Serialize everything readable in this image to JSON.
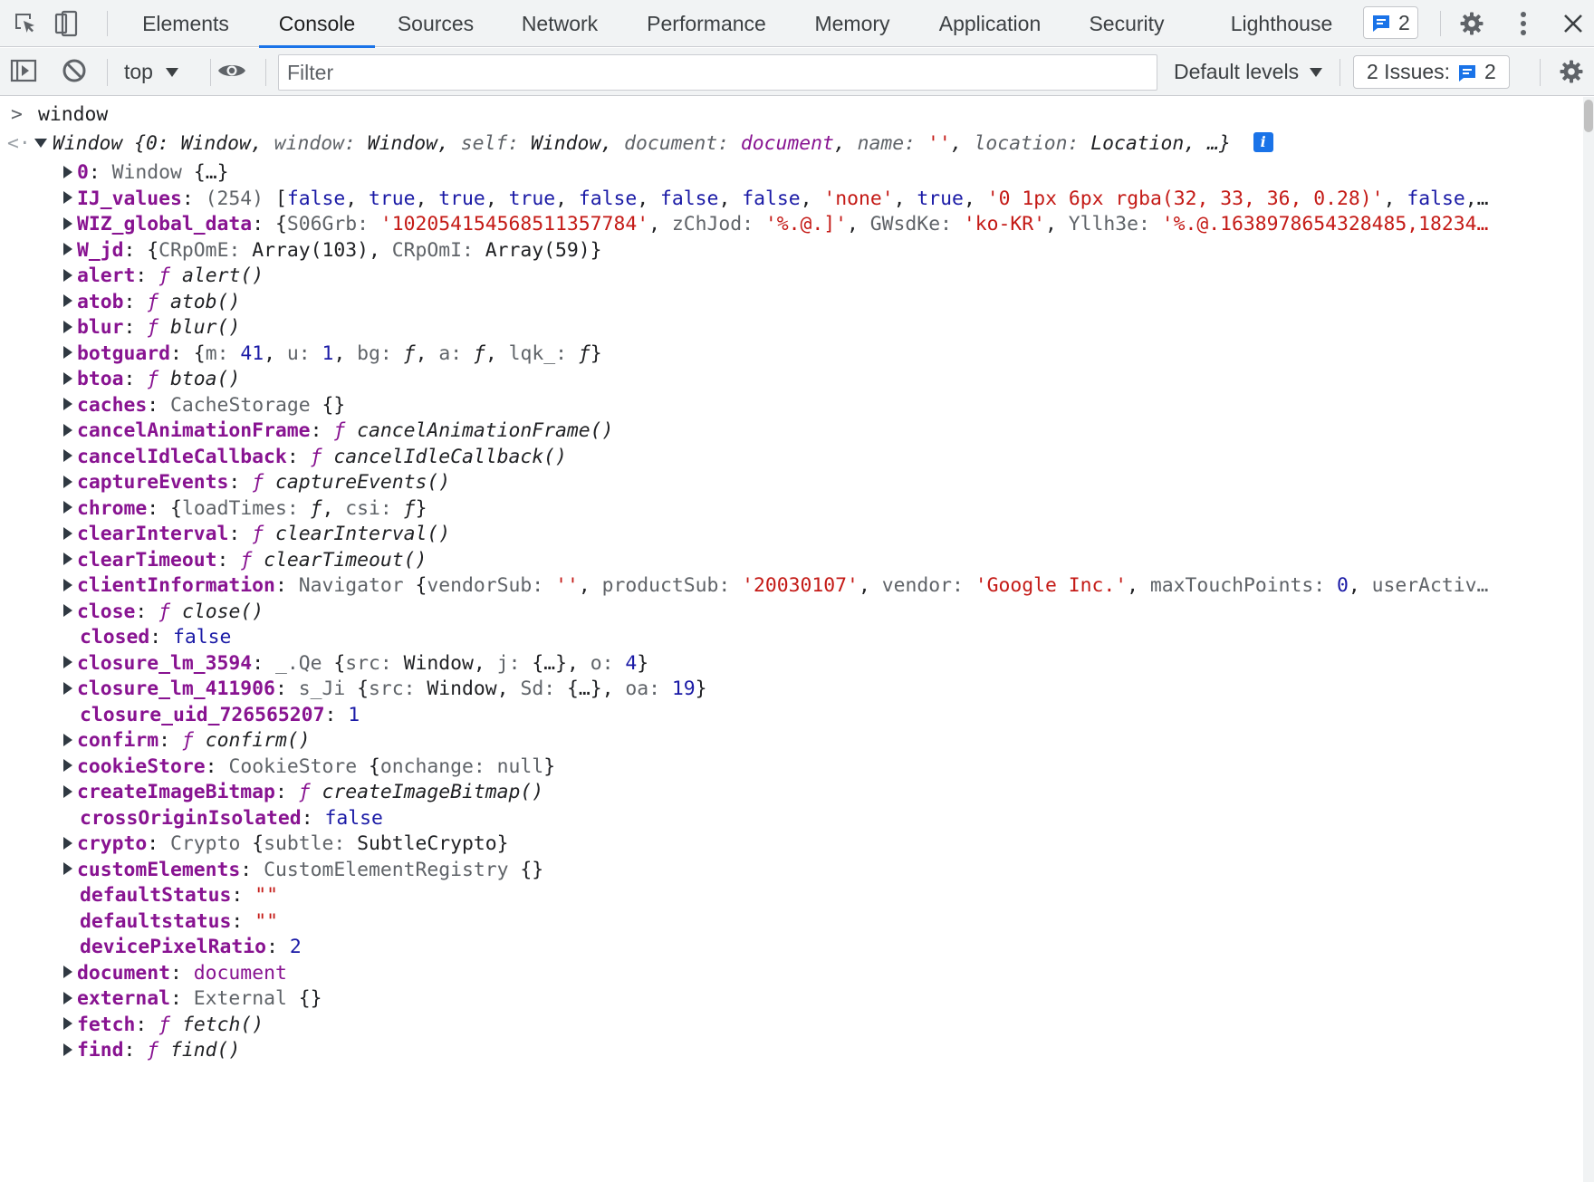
{
  "tabs": [
    {
      "label": "Elements",
      "active": false
    },
    {
      "label": "Console",
      "active": true
    },
    {
      "label": "Sources",
      "active": false
    },
    {
      "label": "Network",
      "active": false
    },
    {
      "label": "Performance",
      "active": false
    },
    {
      "label": "Memory",
      "active": false
    },
    {
      "label": "Application",
      "active": false
    },
    {
      "label": "Security",
      "active": false
    },
    {
      "label": "Lighthouse",
      "active": false
    }
  ],
  "tabbar": {
    "messages_count": "2"
  },
  "toolbar": {
    "context": "top",
    "filter_placeholder": "Filter",
    "levels": "Default levels",
    "issues_label": "2 Issues:",
    "issues_count": "2"
  },
  "colors": {
    "accent": "#1a73e8",
    "key": "#881391",
    "string": "#c41a16",
    "number": "#1a1aa6"
  },
  "console": {
    "input": "window",
    "summary": [
      {
        "c": "t i",
        "v": "Window {"
      },
      {
        "c": "t i",
        "v": "0: Window, "
      },
      {
        "c": "g i",
        "v": "window: "
      },
      {
        "c": "t i",
        "v": "Window, "
      },
      {
        "c": "g i",
        "v": "self: "
      },
      {
        "c": "t i",
        "v": "Window, "
      },
      {
        "c": "g i",
        "v": "document: "
      },
      {
        "c": "kn i",
        "v": "document"
      },
      {
        "c": "t i",
        "v": ", "
      },
      {
        "c": "g i",
        "v": "name: "
      },
      {
        "c": "s i",
        "v": "''"
      },
      {
        "c": "t i",
        "v": ", "
      },
      {
        "c": "g i",
        "v": "location: "
      },
      {
        "c": "t i",
        "v": "Location, …}"
      }
    ],
    "props": [
      {
        "expand": true,
        "key": "0",
        "parts": [
          {
            "c": "g",
            "v": "Window "
          },
          {
            "c": "t",
            "v": "{…}"
          }
        ]
      },
      {
        "expand": true,
        "key": "IJ_values",
        "parts": [
          {
            "c": "g",
            "v": "(254) "
          },
          {
            "c": "t",
            "v": "["
          },
          {
            "c": "n",
            "v": "false"
          },
          {
            "c": "t",
            "v": ", "
          },
          {
            "c": "n",
            "v": "true"
          },
          {
            "c": "t",
            "v": ", "
          },
          {
            "c": "n",
            "v": "true"
          },
          {
            "c": "t",
            "v": ", "
          },
          {
            "c": "n",
            "v": "true"
          },
          {
            "c": "t",
            "v": ", "
          },
          {
            "c": "n",
            "v": "false"
          },
          {
            "c": "t",
            "v": ", "
          },
          {
            "c": "n",
            "v": "false"
          },
          {
            "c": "t",
            "v": ", "
          },
          {
            "c": "n",
            "v": "false"
          },
          {
            "c": "t",
            "v": ", "
          },
          {
            "c": "s",
            "v": "'none'"
          },
          {
            "c": "t",
            "v": ", "
          },
          {
            "c": "n",
            "v": "true"
          },
          {
            "c": "t",
            "v": ", "
          },
          {
            "c": "s",
            "v": "'0 1px 6px rgba(32, 33, 36, 0.28)'"
          },
          {
            "c": "t",
            "v": ", "
          },
          {
            "c": "n",
            "v": "false"
          },
          {
            "c": "t",
            "v": ",…"
          }
        ]
      },
      {
        "expand": true,
        "key": "WIZ_global_data",
        "parts": [
          {
            "c": "t",
            "v": "{"
          },
          {
            "c": "g",
            "v": "S06Grb: "
          },
          {
            "c": "s",
            "v": "'102054154568511357784'"
          },
          {
            "c": "t",
            "v": ", "
          },
          {
            "c": "g",
            "v": "zChJod: "
          },
          {
            "c": "s",
            "v": "'%.@.]'"
          },
          {
            "c": "t",
            "v": ", "
          },
          {
            "c": "g",
            "v": "GWsdKe: "
          },
          {
            "c": "s",
            "v": "'ko-KR'"
          },
          {
            "c": "t",
            "v": ", "
          },
          {
            "c": "g",
            "v": "Yllh3e: "
          },
          {
            "c": "s",
            "v": "'%.@.1638978654328485,18234…"
          }
        ]
      },
      {
        "expand": true,
        "key": "W_jd",
        "parts": [
          {
            "c": "t",
            "v": "{"
          },
          {
            "c": "g",
            "v": "CRpOmE: "
          },
          {
            "c": "t",
            "v": "Array(103), "
          },
          {
            "c": "g",
            "v": "CRpOmI: "
          },
          {
            "c": "t",
            "v": "Array(59)}"
          }
        ]
      },
      {
        "expand": true,
        "key": "alert",
        "parts": [
          {
            "c": "kn i",
            "v": "ƒ "
          },
          {
            "c": "t i",
            "v": "alert()"
          }
        ]
      },
      {
        "expand": true,
        "key": "atob",
        "parts": [
          {
            "c": "kn i",
            "v": "ƒ "
          },
          {
            "c": "t i",
            "v": "atob()"
          }
        ]
      },
      {
        "expand": true,
        "key": "blur",
        "parts": [
          {
            "c": "kn i",
            "v": "ƒ "
          },
          {
            "c": "t i",
            "v": "blur()"
          }
        ]
      },
      {
        "expand": true,
        "key": "botguard",
        "parts": [
          {
            "c": "t",
            "v": "{"
          },
          {
            "c": "g",
            "v": "m: "
          },
          {
            "c": "n",
            "v": "41"
          },
          {
            "c": "t",
            "v": ", "
          },
          {
            "c": "g",
            "v": "u: "
          },
          {
            "c": "n",
            "v": "1"
          },
          {
            "c": "t",
            "v": ", "
          },
          {
            "c": "g",
            "v": "bg: "
          },
          {
            "c": "t i",
            "v": "ƒ"
          },
          {
            "c": "t",
            "v": ", "
          },
          {
            "c": "g",
            "v": "a: "
          },
          {
            "c": "t i",
            "v": "ƒ"
          },
          {
            "c": "t",
            "v": ", "
          },
          {
            "c": "g",
            "v": "lqk_: "
          },
          {
            "c": "t i",
            "v": "ƒ"
          },
          {
            "c": "t",
            "v": "}"
          }
        ]
      },
      {
        "expand": true,
        "key": "btoa",
        "parts": [
          {
            "c": "kn i",
            "v": "ƒ "
          },
          {
            "c": "t i",
            "v": "btoa()"
          }
        ]
      },
      {
        "expand": true,
        "key": "caches",
        "parts": [
          {
            "c": "g",
            "v": "CacheStorage "
          },
          {
            "c": "t",
            "v": "{}"
          }
        ]
      },
      {
        "expand": true,
        "key": "cancelAnimationFrame",
        "parts": [
          {
            "c": "kn i",
            "v": "ƒ "
          },
          {
            "c": "t i",
            "v": "cancelAnimationFrame()"
          }
        ]
      },
      {
        "expand": true,
        "key": "cancelIdleCallback",
        "parts": [
          {
            "c": "kn i",
            "v": "ƒ "
          },
          {
            "c": "t i",
            "v": "cancelIdleCallback()"
          }
        ]
      },
      {
        "expand": true,
        "key": "captureEvents",
        "parts": [
          {
            "c": "kn i",
            "v": "ƒ "
          },
          {
            "c": "t i",
            "v": "captureEvents()"
          }
        ]
      },
      {
        "expand": true,
        "key": "chrome",
        "parts": [
          {
            "c": "t",
            "v": "{"
          },
          {
            "c": "g",
            "v": "loadTimes: "
          },
          {
            "c": "t i",
            "v": "ƒ"
          },
          {
            "c": "t",
            "v": ", "
          },
          {
            "c": "g",
            "v": "csi: "
          },
          {
            "c": "t i",
            "v": "ƒ"
          },
          {
            "c": "t",
            "v": "}"
          }
        ]
      },
      {
        "expand": true,
        "key": "clearInterval",
        "parts": [
          {
            "c": "kn i",
            "v": "ƒ "
          },
          {
            "c": "t i",
            "v": "clearInterval()"
          }
        ]
      },
      {
        "expand": true,
        "key": "clearTimeout",
        "parts": [
          {
            "c": "kn i",
            "v": "ƒ "
          },
          {
            "c": "t i",
            "v": "clearTimeout()"
          }
        ]
      },
      {
        "expand": true,
        "key": "clientInformation",
        "parts": [
          {
            "c": "g",
            "v": "Navigator "
          },
          {
            "c": "t",
            "v": "{"
          },
          {
            "c": "g",
            "v": "vendorSub: "
          },
          {
            "c": "s",
            "v": "''"
          },
          {
            "c": "t",
            "v": ", "
          },
          {
            "c": "g",
            "v": "productSub: "
          },
          {
            "c": "s",
            "v": "'20030107'"
          },
          {
            "c": "t",
            "v": ", "
          },
          {
            "c": "g",
            "v": "vendor: "
          },
          {
            "c": "s",
            "v": "'Google Inc.'"
          },
          {
            "c": "t",
            "v": ", "
          },
          {
            "c": "g",
            "v": "maxTouchPoints: "
          },
          {
            "c": "n",
            "v": "0"
          },
          {
            "c": "t",
            "v": ", "
          },
          {
            "c": "g",
            "v": "userActiv…"
          }
        ]
      },
      {
        "expand": true,
        "key": "close",
        "parts": [
          {
            "c": "kn i",
            "v": "ƒ "
          },
          {
            "c": "t i",
            "v": "close()"
          }
        ]
      },
      {
        "expand": false,
        "key": "closed",
        "parts": [
          {
            "c": "n",
            "v": "false"
          }
        ]
      },
      {
        "expand": true,
        "key": "closure_lm_3594",
        "parts": [
          {
            "c": "g",
            "v": "_.Qe "
          },
          {
            "c": "t",
            "v": "{"
          },
          {
            "c": "g",
            "v": "src: "
          },
          {
            "c": "t",
            "v": "Window, "
          },
          {
            "c": "g",
            "v": "j: "
          },
          {
            "c": "t",
            "v": "{…}, "
          },
          {
            "c": "g",
            "v": "o: "
          },
          {
            "c": "n",
            "v": "4"
          },
          {
            "c": "t",
            "v": "}"
          }
        ]
      },
      {
        "expand": true,
        "key": "closure_lm_411906",
        "parts": [
          {
            "c": "g",
            "v": "s_Ji "
          },
          {
            "c": "t",
            "v": "{"
          },
          {
            "c": "g",
            "v": "src: "
          },
          {
            "c": "t",
            "v": "Window, "
          },
          {
            "c": "g",
            "v": "Sd: "
          },
          {
            "c": "t",
            "v": "{…}, "
          },
          {
            "c": "g",
            "v": "oa: "
          },
          {
            "c": "n",
            "v": "19"
          },
          {
            "c": "t",
            "v": "}"
          }
        ]
      },
      {
        "expand": false,
        "key": "closure_uid_726565207",
        "parts": [
          {
            "c": "n",
            "v": "1"
          }
        ]
      },
      {
        "expand": true,
        "key": "confirm",
        "parts": [
          {
            "c": "kn i",
            "v": "ƒ "
          },
          {
            "c": "t i",
            "v": "confirm()"
          }
        ]
      },
      {
        "expand": true,
        "key": "cookieStore",
        "parts": [
          {
            "c": "g",
            "v": "CookieStore "
          },
          {
            "c": "t",
            "v": "{"
          },
          {
            "c": "g",
            "v": "onchange: "
          },
          {
            "c": "g",
            "v": "null"
          },
          {
            "c": "t",
            "v": "}"
          }
        ]
      },
      {
        "expand": true,
        "key": "createImageBitmap",
        "parts": [
          {
            "c": "kn i",
            "v": "ƒ "
          },
          {
            "c": "t i",
            "v": "createImageBitmap()"
          }
        ]
      },
      {
        "expand": false,
        "key": "crossOriginIsolated",
        "parts": [
          {
            "c": "n",
            "v": "false"
          }
        ]
      },
      {
        "expand": true,
        "key": "crypto",
        "parts": [
          {
            "c": "g",
            "v": "Crypto "
          },
          {
            "c": "t",
            "v": "{"
          },
          {
            "c": "g",
            "v": "subtle: "
          },
          {
            "c": "t",
            "v": "SubtleCrypto}"
          }
        ]
      },
      {
        "expand": true,
        "key": "customElements",
        "parts": [
          {
            "c": "g",
            "v": "CustomElementRegistry "
          },
          {
            "c": "t",
            "v": "{}"
          }
        ]
      },
      {
        "expand": false,
        "key": "defaultStatus",
        "parts": [
          {
            "c": "s",
            "v": "\"\""
          }
        ]
      },
      {
        "expand": false,
        "key": "defaultstatus",
        "parts": [
          {
            "c": "s",
            "v": "\"\""
          }
        ]
      },
      {
        "expand": false,
        "key": "devicePixelRatio",
        "parts": [
          {
            "c": "n",
            "v": "2"
          }
        ]
      },
      {
        "expand": true,
        "key": "document",
        "parts": [
          {
            "c": "kn",
            "v": "document"
          }
        ]
      },
      {
        "expand": true,
        "key": "external",
        "parts": [
          {
            "c": "g",
            "v": "External "
          },
          {
            "c": "t",
            "v": "{}"
          }
        ]
      },
      {
        "expand": true,
        "key": "fetch",
        "parts": [
          {
            "c": "kn i",
            "v": "ƒ "
          },
          {
            "c": "t i",
            "v": "fetch()"
          }
        ]
      },
      {
        "expand": true,
        "key": "find",
        "parts": [
          {
            "c": "kn i",
            "v": "ƒ "
          },
          {
            "c": "t i",
            "v": "find()"
          }
        ]
      }
    ]
  }
}
